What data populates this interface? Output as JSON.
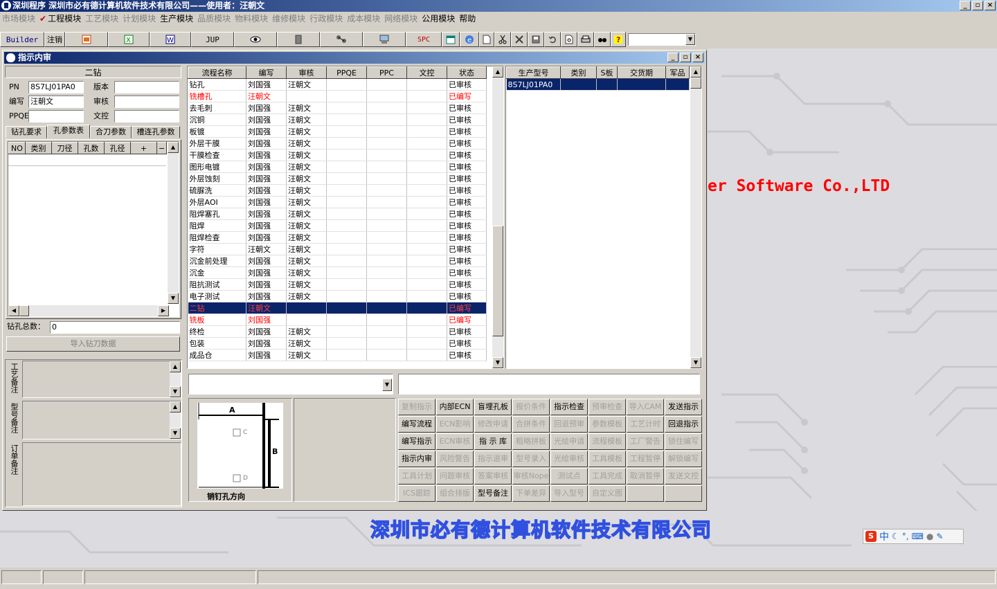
{
  "window": {
    "title": "深圳程序    深圳市必有德计算机软件技术有限公司——使用者：汪朝文"
  },
  "menu": [
    {
      "label": "市场模块",
      "enabled": false
    },
    {
      "label": "工程模块",
      "enabled": true,
      "checked": true
    },
    {
      "label": "工艺模块",
      "enabled": false
    },
    {
      "label": "计划模块",
      "enabled": false
    },
    {
      "label": "生产模块",
      "enabled": true
    },
    {
      "label": "品质模块",
      "enabled": false
    },
    {
      "label": "物料模块",
      "enabled": false
    },
    {
      "label": "维修模块",
      "enabled": false
    },
    {
      "label": "行政模块",
      "enabled": false
    },
    {
      "label": "成本模块",
      "enabled": false
    },
    {
      "label": "网络模块",
      "enabled": false
    },
    {
      "label": "公用模块",
      "enabled": true
    },
    {
      "label": "帮助",
      "enabled": true
    }
  ],
  "toolbar": {
    "builder": "Builder",
    "logout": "注销",
    "jup": "JUP",
    "spc": "SPC"
  },
  "child": {
    "title": "指示内审"
  },
  "left": {
    "header": "二钻",
    "pn_label": "PN",
    "pn_value": "8S7LJ01PA0",
    "version_label": "版本",
    "version_value": "",
    "author_label": "编写",
    "author_value": "汪朝文",
    "review_label": "审核",
    "review_value": "",
    "ppqe_label": "PPQE",
    "ppqe_value": "",
    "doc_label": "文控",
    "doc_value": "",
    "tabs": [
      "钻孔要求",
      "孔参数表",
      "合刀参数",
      "槽连孔参数"
    ],
    "active_tab": 1,
    "grid_cols": [
      "NO",
      "类别",
      "刀径",
      "孔数",
      "孔径",
      "+",
      "−"
    ],
    "total_label": "钻孔总数：",
    "total_value": "0",
    "import_btn": "导入钻刀数据",
    "remarks": [
      "工艺备注",
      "型号备注",
      "订单备注"
    ]
  },
  "process": {
    "cols": [
      "流程名称",
      "编写",
      "审核",
      "PPQE",
      "PPC",
      "文控",
      "状态"
    ],
    "rows": [
      {
        "name": "钻孔",
        "author": "刘国强",
        "reviewer": "汪朝文",
        "status": "已审核",
        "red": false
      },
      {
        "name": "铣槽孔",
        "author": "汪朝文",
        "reviewer": "",
        "status": "已编写",
        "red": true
      },
      {
        "name": "去毛刺",
        "author": "刘国强",
        "reviewer": "汪朝文",
        "status": "已审核",
        "red": false
      },
      {
        "name": "沉铜",
        "author": "刘国强",
        "reviewer": "汪朝文",
        "status": "已审核",
        "red": false
      },
      {
        "name": "板镀",
        "author": "刘国强",
        "reviewer": "汪朝文",
        "status": "已审核",
        "red": false
      },
      {
        "name": "外层干膜",
        "author": "刘国强",
        "reviewer": "汪朝文",
        "status": "已审核",
        "red": false
      },
      {
        "name": "干膜检查",
        "author": "刘国强",
        "reviewer": "汪朝文",
        "status": "已审核",
        "red": false
      },
      {
        "name": "图形电镀",
        "author": "刘国强",
        "reviewer": "汪朝文",
        "status": "已审核",
        "red": false
      },
      {
        "name": "外层蚀刻",
        "author": "刘国强",
        "reviewer": "汪朝文",
        "status": "已审核",
        "red": false
      },
      {
        "name": "硫脲洗",
        "author": "刘国强",
        "reviewer": "汪朝文",
        "status": "已审核",
        "red": false
      },
      {
        "name": "外层AOI",
        "author": "刘国强",
        "reviewer": "汪朝文",
        "status": "已审核",
        "red": false
      },
      {
        "name": "阻焊塞孔",
        "author": "刘国强",
        "reviewer": "汪朝文",
        "status": "已审核",
        "red": false
      },
      {
        "name": "阻焊",
        "author": "刘国强",
        "reviewer": "汪朝文",
        "status": "已审核",
        "red": false
      },
      {
        "name": "阻焊检查",
        "author": "刘国强",
        "reviewer": "汪朝文",
        "status": "已审核",
        "red": false
      },
      {
        "name": "字符",
        "author": "汪朝文",
        "reviewer": "汪朝文",
        "status": "已审核",
        "red": false
      },
      {
        "name": "沉金前处理",
        "author": "刘国强",
        "reviewer": "汪朝文",
        "status": "已审核",
        "red": false
      },
      {
        "name": "沉金",
        "author": "刘国强",
        "reviewer": "汪朝文",
        "status": "已审核",
        "red": false
      },
      {
        "name": "阻抗测试",
        "author": "刘国强",
        "reviewer": "汪朝文",
        "status": "已审核",
        "red": false
      },
      {
        "name": "电子测试",
        "author": "刘国强",
        "reviewer": "汪朝文",
        "status": "已审核",
        "red": false
      },
      {
        "name": "二钻",
        "author": "汪朝文",
        "reviewer": "",
        "status": "已编写",
        "red": true,
        "selected": true
      },
      {
        "name": "铣板",
        "author": "刘国强",
        "reviewer": "",
        "status": "已编写",
        "red": true
      },
      {
        "name": "终检",
        "author": "刘国强",
        "reviewer": "汪朝文",
        "status": "已审核",
        "red": false
      },
      {
        "name": "包装",
        "author": "刘国强",
        "reviewer": "汪朝文",
        "status": "已审核",
        "red": false
      },
      {
        "name": "成品仓",
        "author": "刘国强",
        "reviewer": "汪朝文",
        "status": "已审核",
        "red": false
      }
    ]
  },
  "models": {
    "cols": [
      "生产型号",
      "类别",
      "S板",
      "交货期",
      "军品"
    ],
    "rows": [
      {
        "model": "8S7LJ01PA0"
      }
    ]
  },
  "pin": {
    "caption": "销钉孔方向",
    "a": "A",
    "b": "B",
    "c": "C",
    "d": "D"
  },
  "actions": [
    [
      {
        "l": "复制指示",
        "e": false
      },
      {
        "l": "内部ECN",
        "e": true
      },
      {
        "l": "盲埋孔板",
        "e": true
      },
      {
        "l": "报价条件",
        "e": false
      },
      {
        "l": "指示检查",
        "e": true
      },
      {
        "l": "预审检查",
        "e": false
      },
      {
        "l": "导入CAM",
        "e": false
      },
      {
        "l": "发送指示",
        "e": true
      }
    ],
    [
      {
        "l": "编写流程",
        "e": true
      },
      {
        "l": "ECN影响",
        "e": false
      },
      {
        "l": "修改申请",
        "e": false
      },
      {
        "l": "合拼条件",
        "e": false
      },
      {
        "l": "回退预审",
        "e": false
      },
      {
        "l": "参数模板",
        "e": false
      },
      {
        "l": "工艺计时",
        "e": false
      },
      {
        "l": "回退指示",
        "e": true
      }
    ],
    [
      {
        "l": "编写指示",
        "e": true
      },
      {
        "l": "ECN审核",
        "e": false
      },
      {
        "l": "指 示 库",
        "e": true
      },
      {
        "l": "粗略拼板",
        "e": false
      },
      {
        "l": "光绘申请",
        "e": false
      },
      {
        "l": "流程模板",
        "e": false
      },
      {
        "l": "工厂警告",
        "e": false
      },
      {
        "l": "锁住编写",
        "e": false
      }
    ],
    [
      {
        "l": "指示内审",
        "e": true
      },
      {
        "l": "风险警告",
        "e": false
      },
      {
        "l": "指示退审",
        "e": false
      },
      {
        "l": "型号录入",
        "e": false
      },
      {
        "l": "光绘审核",
        "e": false
      },
      {
        "l": "工具模板",
        "e": false
      },
      {
        "l": "工程暂停",
        "e": false
      },
      {
        "l": "解锁编写",
        "e": false
      }
    ],
    [
      {
        "l": "工具计划",
        "e": false
      },
      {
        "l": "问题审核",
        "e": false
      },
      {
        "l": "答案审核",
        "e": false
      },
      {
        "l": "审核Nope",
        "e": false
      },
      {
        "l": "测试点",
        "e": false
      },
      {
        "l": "工具完成",
        "e": false
      },
      {
        "l": "取消暂停",
        "e": false
      },
      {
        "l": "发送文控",
        "e": false
      }
    ],
    [
      {
        "l": "ICS跟踪",
        "e": false
      },
      {
        "l": "组合排版",
        "e": false
      },
      {
        "l": "型号备注",
        "e": true
      },
      {
        "l": "下单差异",
        "e": false
      },
      {
        "l": "导入型号",
        "e": false
      },
      {
        "l": "自定义图",
        "e": false
      },
      {
        "l": "",
        "e": false
      },
      {
        "l": "",
        "e": false
      }
    ]
  ],
  "desktop": {
    "english": "er Software Co.,LTD",
    "chinese": "深圳市必有德计算机软件技术有限公司"
  },
  "ime": {
    "text": "中"
  }
}
